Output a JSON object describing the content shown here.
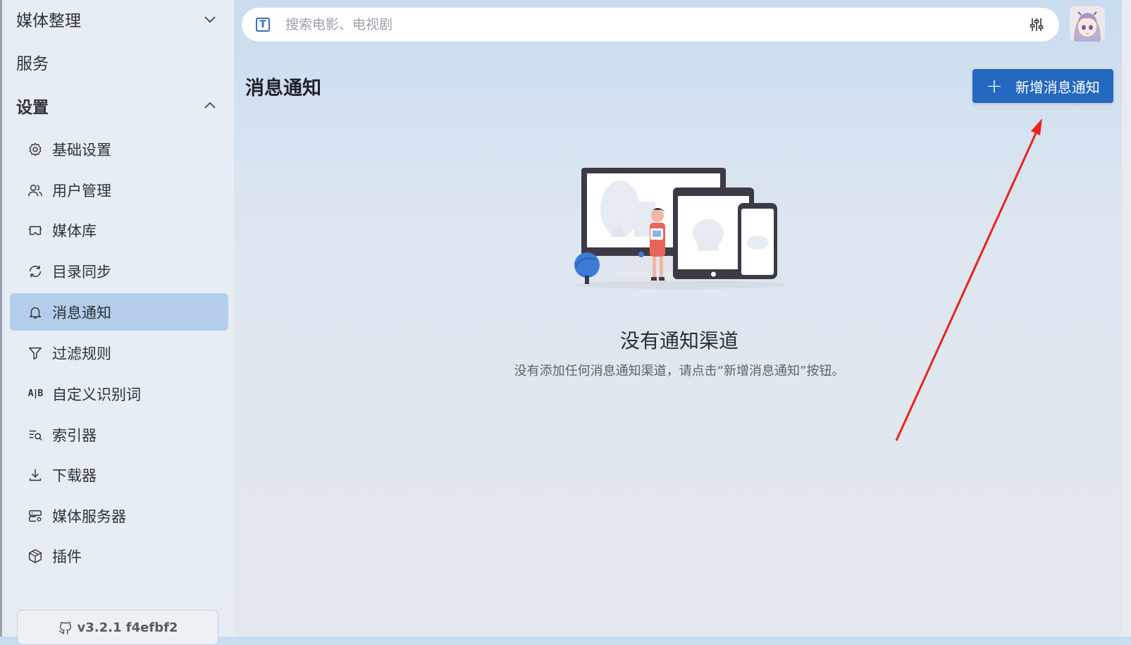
{
  "sidebar": {
    "group_media": "媒体整理",
    "group_service": "服务",
    "group_settings": "设置",
    "items": [
      {
        "label": "基础设置",
        "icon": "gear-icon"
      },
      {
        "label": "用户管理",
        "icon": "users-icon"
      },
      {
        "label": "媒体库",
        "icon": "vr-library-icon"
      },
      {
        "label": "目录同步",
        "icon": "sync-icon"
      },
      {
        "label": "消息通知",
        "icon": "bell-icon",
        "active": true
      },
      {
        "label": "过滤规则",
        "icon": "filter-icon"
      },
      {
        "label": "自定义识别词",
        "icon": "ab-icon"
      },
      {
        "label": "索引器",
        "icon": "search-list-icon"
      },
      {
        "label": "下载器",
        "icon": "download-icon"
      },
      {
        "label": "媒体服务器",
        "icon": "server-icon"
      },
      {
        "label": "插件",
        "icon": "cube-icon"
      }
    ],
    "ab_glyph": "A|B",
    "version": "v3.2.1 f4efbf2"
  },
  "search": {
    "placeholder": "搜索电影、电视剧",
    "type_glyph": "T"
  },
  "page": {
    "title": "消息通知",
    "add_button": "新增消息通知",
    "plus_glyph": "+",
    "empty_title": "没有通知渠道",
    "empty_desc": "没有添加任何消息通知渠道，请点击“新增消息通知”按钮。"
  },
  "colors": {
    "accent": "#2468c0",
    "active_item": "#b3cdeb",
    "annotation_arrow": "#e8231b"
  }
}
